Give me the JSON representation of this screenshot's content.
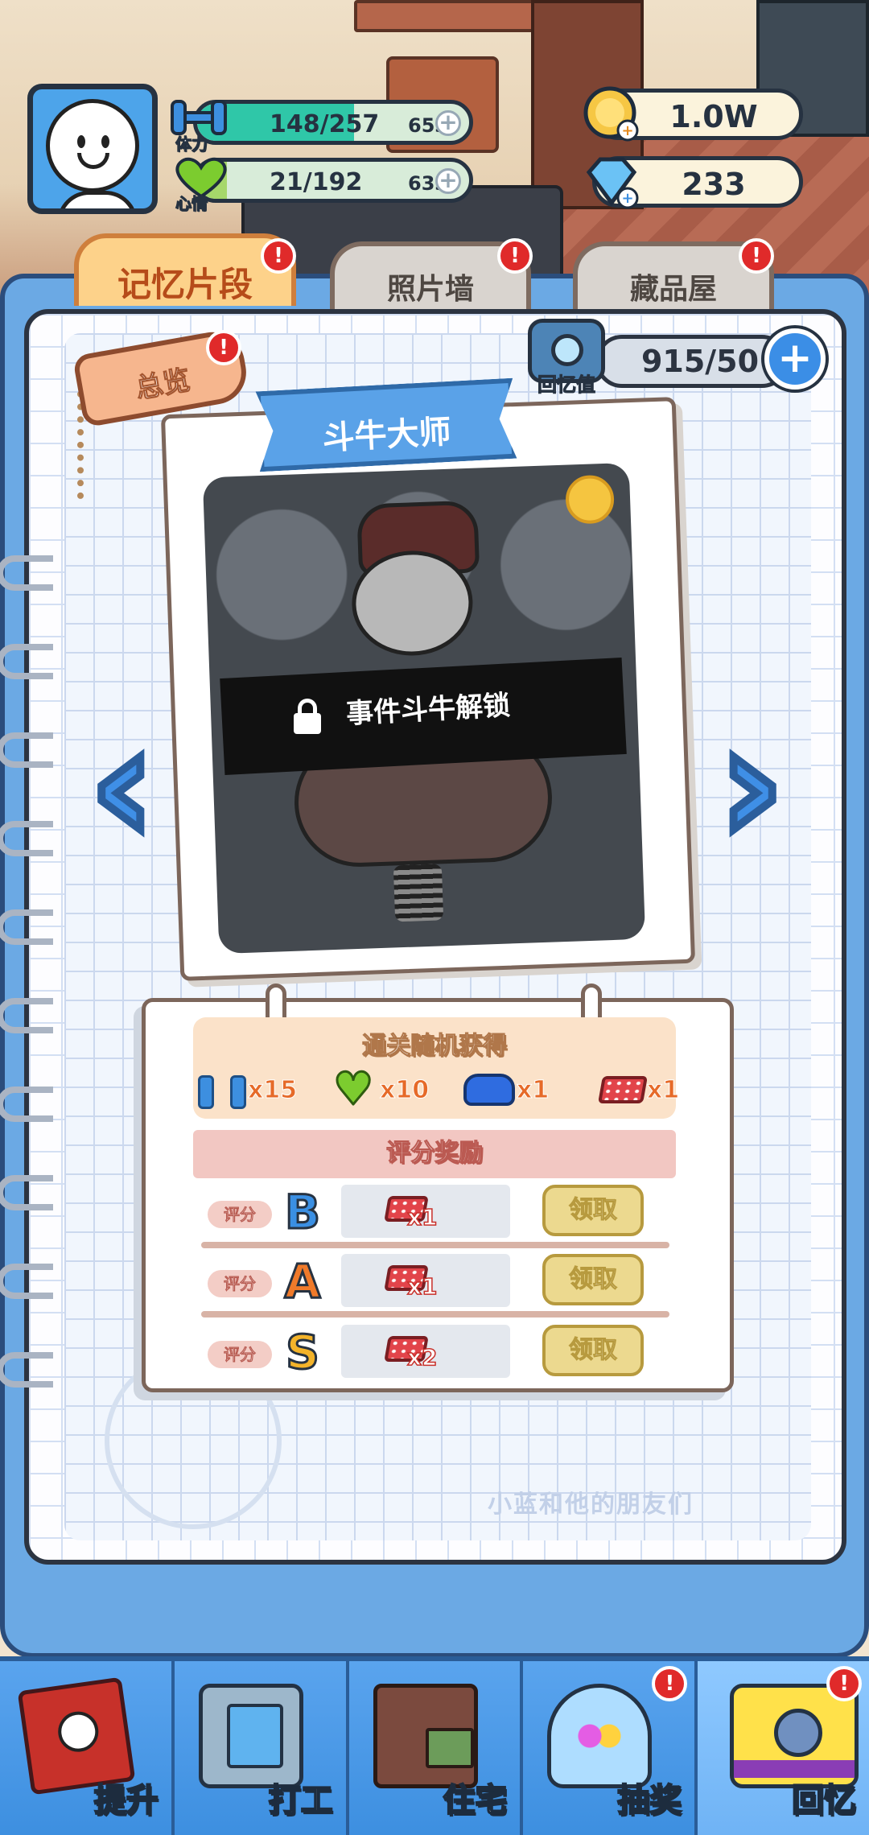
{
  "hud": {
    "stamina": {
      "label": "体力",
      "value": "148/257",
      "timer": "65s",
      "fill": 0.576,
      "color": "#2fc7a8"
    },
    "mood": {
      "label": "心情",
      "value": "21/192",
      "timer": "63s",
      "fill": 0.11,
      "color": "#a6d76a"
    },
    "coins": {
      "value": "1.0W"
    },
    "diamonds": {
      "value": "233"
    }
  },
  "tabs": [
    {
      "label": "记忆片段",
      "active": true,
      "badge": "!"
    },
    {
      "label": "照片墙",
      "active": false,
      "badge": "!"
    },
    {
      "label": "藏品屋",
      "active": false,
      "badge": "!"
    }
  ],
  "page": {
    "overview_tag": "总览",
    "overview_badge": "!",
    "memory_label": "回忆值",
    "memory_value": "915/50",
    "plus_symbol": "+"
  },
  "card": {
    "title": "斗牛大师",
    "locked_text": "事件斗牛解锁",
    "prev_glyph": "‹",
    "next_glyph": "›"
  },
  "rewards": {
    "drop_title": "通关随机获得",
    "drops": [
      {
        "icon": "dumbbell-icon",
        "qty": "x15"
      },
      {
        "icon": "heart-icon",
        "qty": "x10"
      },
      {
        "icon": "car-icon",
        "qty": "x1"
      },
      {
        "icon": "brick-icon",
        "qty": "x1"
      }
    ],
    "score_title": "评分奖励",
    "scores": [
      {
        "pill": "评分",
        "grade": "B",
        "grade_color": "#3a8fe3",
        "qty": "x1",
        "button": "领取"
      },
      {
        "pill": "评分",
        "grade": "A",
        "grade_color": "#f07a2a",
        "qty": "x1",
        "button": "领取"
      },
      {
        "pill": "评分",
        "grade": "S",
        "grade_color": "#f3b32a",
        "qty": "x2",
        "button": "领取"
      }
    ]
  },
  "decoration": {
    "footer_text": "小蓝和他的朋友们"
  },
  "nav": [
    {
      "label": "提升",
      "badge": ""
    },
    {
      "label": "打工",
      "badge": ""
    },
    {
      "label": "住宅",
      "badge": ""
    },
    {
      "label": "抽奖",
      "badge": "!"
    },
    {
      "label": "回忆",
      "badge": "!"
    }
  ]
}
